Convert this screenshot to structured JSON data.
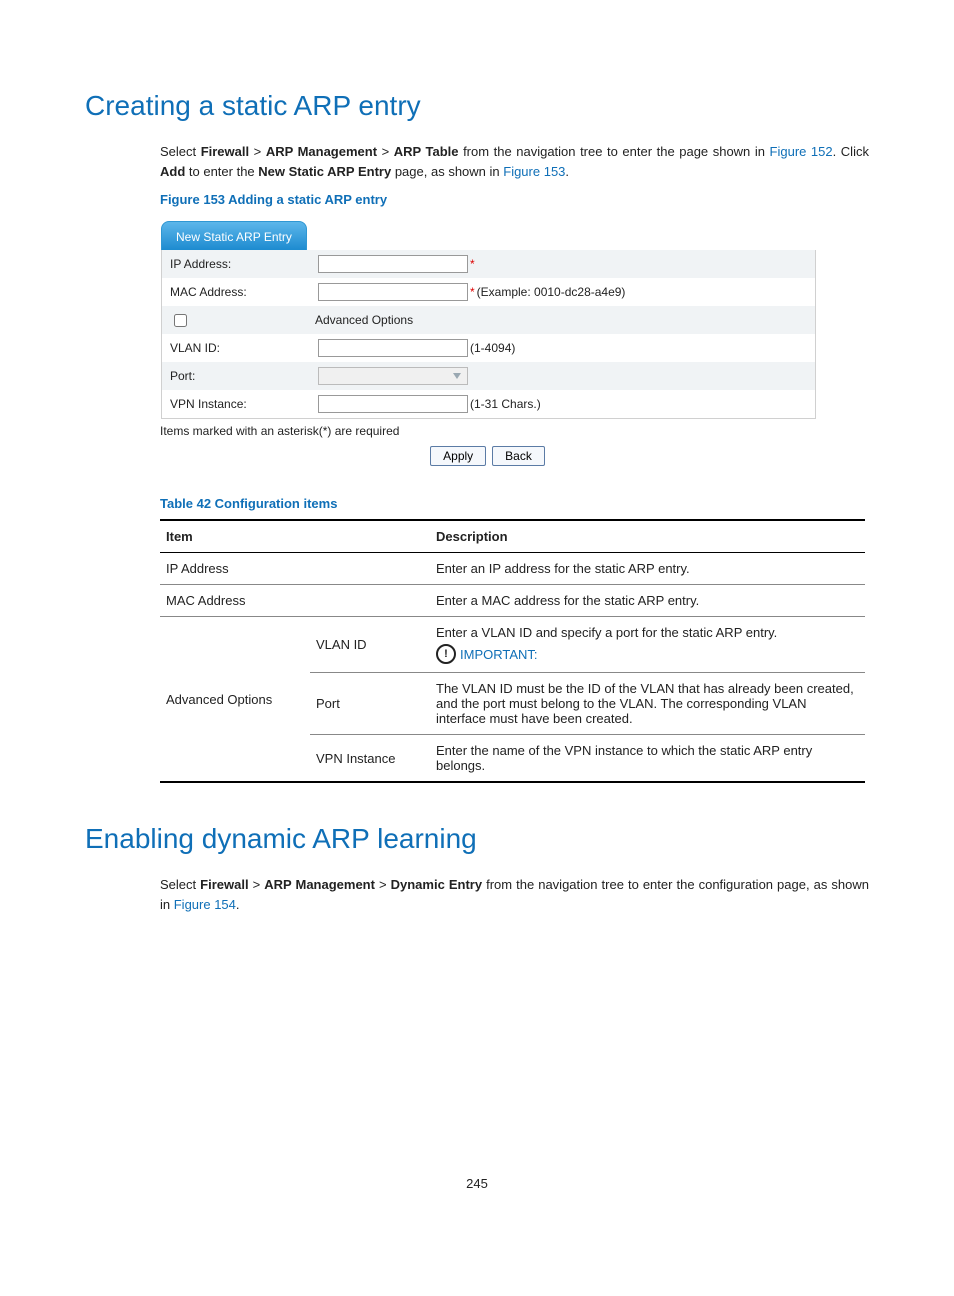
{
  "section1": {
    "heading": "Creating a static ARP entry",
    "para_parts": {
      "p1a": "Select ",
      "fw": "Firewall",
      "gt1": " > ",
      "arpmgmt": "ARP Management",
      "gt2": " > ",
      "arptable": "ARP Table",
      "p1b": " from the navigation tree to enter the page shown in ",
      "fig152": "Figure 152",
      "p1c": ". Click ",
      "add": "Add",
      "p1d": " to enter the ",
      "newentry": "New Static ARP Entry",
      "p1e": " page, as shown in ",
      "fig153": "Figure 153",
      "p1f": "."
    },
    "figcap": "Figure 153 Adding a static ARP entry"
  },
  "form": {
    "tab": "New Static ARP Entry",
    "ip_label": "IP Address:",
    "mac_label": "MAC Address:",
    "mac_hint": "(Example: 0010-dc28-a4e9)",
    "advopt": "Advanced Options",
    "vlan_label": "VLAN ID:",
    "vlan_hint": "(1-4094)",
    "port_label": "Port:",
    "vpn_label": "VPN Instance:",
    "vpn_hint": "(1-31 Chars.)",
    "note": "Items marked with an asterisk(*) are required",
    "apply": "Apply",
    "back": "Back",
    "star": "*"
  },
  "table": {
    "caption": "Table 42 Configuration items",
    "h_item": "Item",
    "h_desc": "Description",
    "r_ip_item": "IP Address",
    "r_ip_desc": "Enter an IP address for the static ARP entry.",
    "r_mac_item": "MAC Address",
    "r_mac_desc": "Enter a MAC address for the static ARP entry.",
    "r_adv": "Advanced Options",
    "r_vlan": "VLAN ID",
    "r_vlan_desc": "Enter a VLAN ID and specify a port for the static ARP entry.",
    "important_label": "IMPORTANT:",
    "r_port": "Port",
    "r_port_desc": "The VLAN ID must be the ID of the VLAN that has already been created, and the port must belong to the VLAN. The corresponding VLAN interface must have been created.",
    "r_vpn": "VPN Instance",
    "r_vpn_desc": "Enter the name of the VPN instance to which the static ARP entry belongs."
  },
  "section2": {
    "heading": "Enabling dynamic ARP learning",
    "p_parts": {
      "a": "Select ",
      "fw": "Firewall",
      "gt1": " > ",
      "arpmgmt": "ARP Management",
      "gt2": " > ",
      "dyn": "Dynamic Entry",
      "b": " from the navigation tree to enter the configuration page, as shown in ",
      "fig154": "Figure 154",
      "c": "."
    }
  },
  "pagenum": "245"
}
